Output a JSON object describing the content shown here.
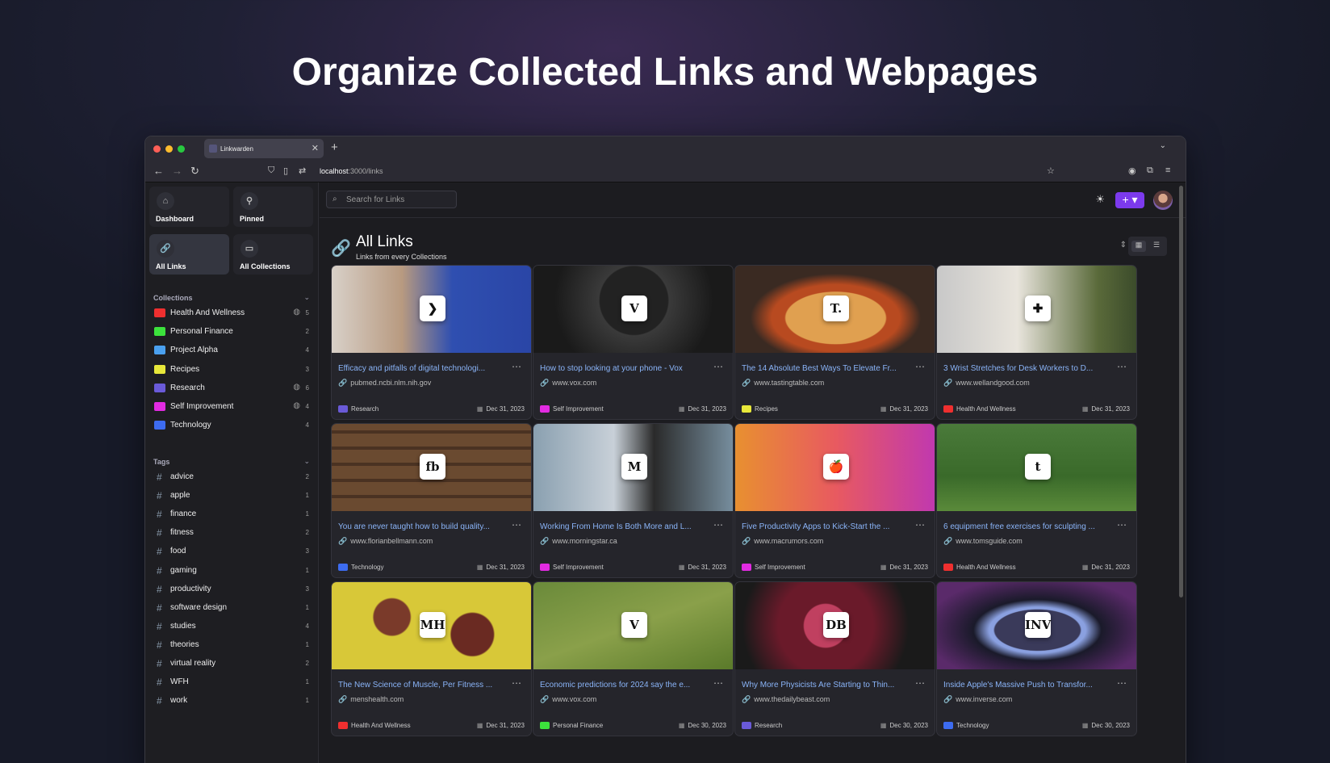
{
  "hero": {
    "title": "Organize Collected Links and Webpages"
  },
  "browser": {
    "tab_title": "Linkwarden",
    "url_host": "localhost",
    "url_path": ":3000/links"
  },
  "sidebar": {
    "nav": [
      {
        "label": "Dashboard",
        "icon": "house-icon"
      },
      {
        "label": "Pinned",
        "icon": "pin-icon"
      },
      {
        "label": "All Links",
        "icon": "link-icon"
      },
      {
        "label": "All Collections",
        "icon": "folder-icon"
      }
    ],
    "collections_heading": "Collections",
    "collections": [
      {
        "name": "Health And Wellness",
        "count": "5",
        "color": "#ef2f2f",
        "shared": true
      },
      {
        "name": "Personal Finance",
        "count": "2",
        "color": "#3ce23c",
        "shared": false
      },
      {
        "name": "Project Alpha",
        "count": "4",
        "color": "#4aa0ef",
        "shared": false
      },
      {
        "name": "Recipes",
        "count": "3",
        "color": "#e8e83a",
        "shared": false
      },
      {
        "name": "Research",
        "count": "6",
        "color": "#6a5ad8",
        "shared": true
      },
      {
        "name": "Self Improvement",
        "count": "4",
        "color": "#e22be2",
        "shared": true
      },
      {
        "name": "Technology",
        "count": "4",
        "color": "#3d6cf0",
        "shared": false
      }
    ],
    "tags_heading": "Tags",
    "tags": [
      {
        "name": "advice",
        "count": "2"
      },
      {
        "name": "apple",
        "count": "1"
      },
      {
        "name": "finance",
        "count": "1"
      },
      {
        "name": "fitness",
        "count": "2"
      },
      {
        "name": "food",
        "count": "3"
      },
      {
        "name": "gaming",
        "count": "1"
      },
      {
        "name": "productivity",
        "count": "3"
      },
      {
        "name": "software design",
        "count": "1"
      },
      {
        "name": "studies",
        "count": "4"
      },
      {
        "name": "theories",
        "count": "1"
      },
      {
        "name": "virtual reality",
        "count": "2"
      },
      {
        "name": "WFH",
        "count": "1"
      },
      {
        "name": "work",
        "count": "1"
      }
    ]
  },
  "search": {
    "placeholder": "Search for Links"
  },
  "header": {
    "title": "All Links",
    "subtitle": "Links from every Collections"
  },
  "accent": "#7c3aed",
  "links": [
    {
      "title": "Efficacy and pitfalls of digital technologi...",
      "domain": "pubmed.ncbi.nlm.nih.gov",
      "collection": "Research",
      "color": "#6a5ad8",
      "date": "Dec 31, 2023",
      "logo": "❯",
      "thumb": "linear-gradient(90deg,#d8d0c8 0%,#b89a80 35%,#2f4fb0 60%,#2a45a6 100%)"
    },
    {
      "title": "How to stop looking at your phone - Vox",
      "domain": "www.vox.com",
      "collection": "Self Improvement",
      "color": "#e22be2",
      "date": "Dec 31, 2023",
      "logo": "V",
      "thumb": "radial-gradient(circle at 50% 40%,#222 0 30%,#3a3a3a 31%,#1a1a1a 70%)"
    },
    {
      "title": "The 14 Absolute Best Ways To Elevate Fr...",
      "domain": "www.tastingtable.com",
      "collection": "Recipes",
      "color": "#e8e83a",
      "date": "Dec 31, 2023",
      "logo": "T.",
      "thumb": "radial-gradient(ellipse at 50% 60%,#e0a050 0 35%,#b84a20 36% 45%,#3a2a22 60%)"
    },
    {
      "title": "3 Wrist Stretches for Desk Workers to D...",
      "domain": "www.wellandgood.com",
      "collection": "Health And Wellness",
      "color": "#ef2f2f",
      "date": "Dec 31, 2023",
      "logo": "✚",
      "thumb": "linear-gradient(90deg,#c8c8c8 0%,#e8e4dc 40%,#5a6a3a 80%,#3a4a2a 100%)"
    },
    {
      "title": "You are never taught how to build quality...",
      "domain": "www.florianbellmann.com",
      "collection": "Technology",
      "color": "#3d6cf0",
      "date": "Dec 31, 2023",
      "logo": "fb",
      "thumb": "repeating-linear-gradient(0deg,#6a4a30 0 16px,#4a3222 16px 20px)"
    },
    {
      "title": "Working From Home Is Both More and L...",
      "domain": "www.morningstar.ca",
      "collection": "Self Improvement",
      "color": "#e22be2",
      "date": "Dec 31, 2023",
      "logo": "M",
      "thumb": "linear-gradient(90deg,#8aa0b0 0%,#c8d0d8 40%,#2a2a2a 60%,#7890a0 100%)"
    },
    {
      "title": "Five Productivity Apps to Kick-Start the ...",
      "domain": "www.macrumors.com",
      "collection": "Self Improvement",
      "color": "#e22be2",
      "date": "Dec 31, 2023",
      "logo": "🍎",
      "thumb": "linear-gradient(90deg,#e89030 0%,#e85a60 50%,#c038b0 100%)"
    },
    {
      "title": "6 equipment free exercises for sculpting ...",
      "domain": "www.tomsguide.com",
      "collection": "Health And Wellness",
      "color": "#ef2f2f",
      "date": "Dec 31, 2023",
      "logo": "t",
      "thumb": "linear-gradient(180deg,#4a7a3a 0%,#3a6a2a 60%,#5a8a3a 100%)"
    },
    {
      "title": "The New Science of Muscle, Per Fitness ...",
      "domain": "menshealth.com",
      "collection": "Health And Wellness",
      "color": "#ef2f2f",
      "date": "Dec 31, 2023",
      "logo": "MH",
      "thumb": "radial-gradient(circle at 30% 40%,#7a3a2a 0 12%,transparent 13%),radial-gradient(circle at 70% 60%,#6a2a22 0 14%,transparent 15%),#d8c838"
    },
    {
      "title": "Economic predictions for 2024 say the e...",
      "domain": "www.vox.com",
      "collection": "Personal Finance",
      "color": "#3ce23c",
      "date": "Dec 30, 2023",
      "logo": "V",
      "thumb": "linear-gradient(160deg,#6a8a3a 0%,#8aa04a 50%,#5a7a2a 100%)"
    },
    {
      "title": "Why More Physicists Are Starting to Thin...",
      "domain": "www.thedailybeast.com",
      "collection": "Research",
      "color": "#6a5ad8",
      "date": "Dec 30, 2023",
      "logo": "DB",
      "thumb": "radial-gradient(circle at 45% 50%,#c04060 0 18%,#6a1a2a 19% 40%,#1a1a1a 70%)"
    },
    {
      "title": "Inside Apple's Massive Push to Transfor...",
      "domain": "www.inverse.com",
      "collection": "Technology",
      "color": "#3d6cf0",
      "date": "Dec 30, 2023",
      "logo": "INV",
      "thumb": "radial-gradient(ellipse at 50% 55%,#3a3a5a 0 30%,#8aa0e0 31% 34%,#1a1a2a 45%,#5a2a6a 80%)"
    }
  ]
}
